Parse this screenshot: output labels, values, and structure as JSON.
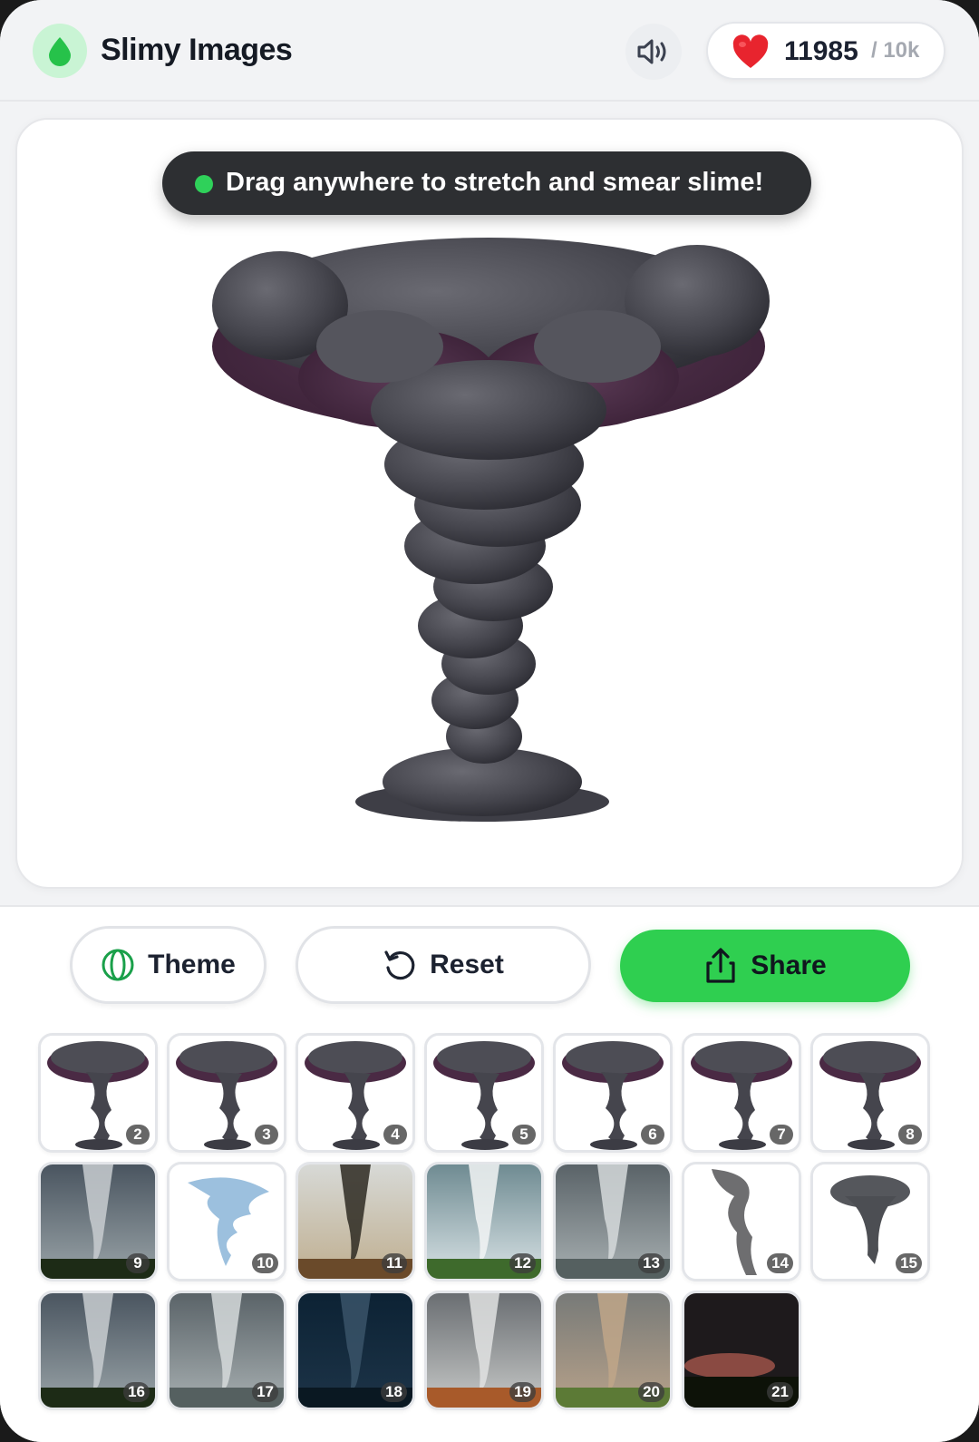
{
  "header": {
    "title": "Slimy Images",
    "hearts_count": "11985",
    "hearts_max": "/ 10k"
  },
  "canvas": {
    "hint": "Drag anywhere to stretch and smear slime!"
  },
  "actions": {
    "theme_label": "Theme",
    "reset_label": "Reset",
    "share_label": "Share"
  },
  "thumbnails": [
    {
      "num": "2",
      "style": "slime"
    },
    {
      "num": "3",
      "style": "slime"
    },
    {
      "num": "4",
      "style": "slime"
    },
    {
      "num": "5",
      "style": "slime"
    },
    {
      "num": "6",
      "style": "slime"
    },
    {
      "num": "7",
      "style": "slime"
    },
    {
      "num": "8",
      "style": "slime"
    },
    {
      "num": "9",
      "style": "photo-storm"
    },
    {
      "num": "10",
      "style": "white-swirl"
    },
    {
      "num": "11",
      "style": "photo-dark"
    },
    {
      "num": "12",
      "style": "photo-light"
    },
    {
      "num": "13",
      "style": "photo-grey"
    },
    {
      "num": "14",
      "style": "white-smoke"
    },
    {
      "num": "15",
      "style": "white-grey"
    },
    {
      "num": "16",
      "style": "photo-storm"
    },
    {
      "num": "17",
      "style": "photo-grey"
    },
    {
      "num": "18",
      "style": "photo-night"
    },
    {
      "num": "19",
      "style": "photo-orange"
    },
    {
      "num": "20",
      "style": "photo-dust"
    },
    {
      "num": "21",
      "style": "photo-sunset"
    }
  ],
  "colors": {
    "accent": "#2fcf50",
    "slime": "#4a4a52",
    "slime_tint": "#5a2a4a"
  }
}
